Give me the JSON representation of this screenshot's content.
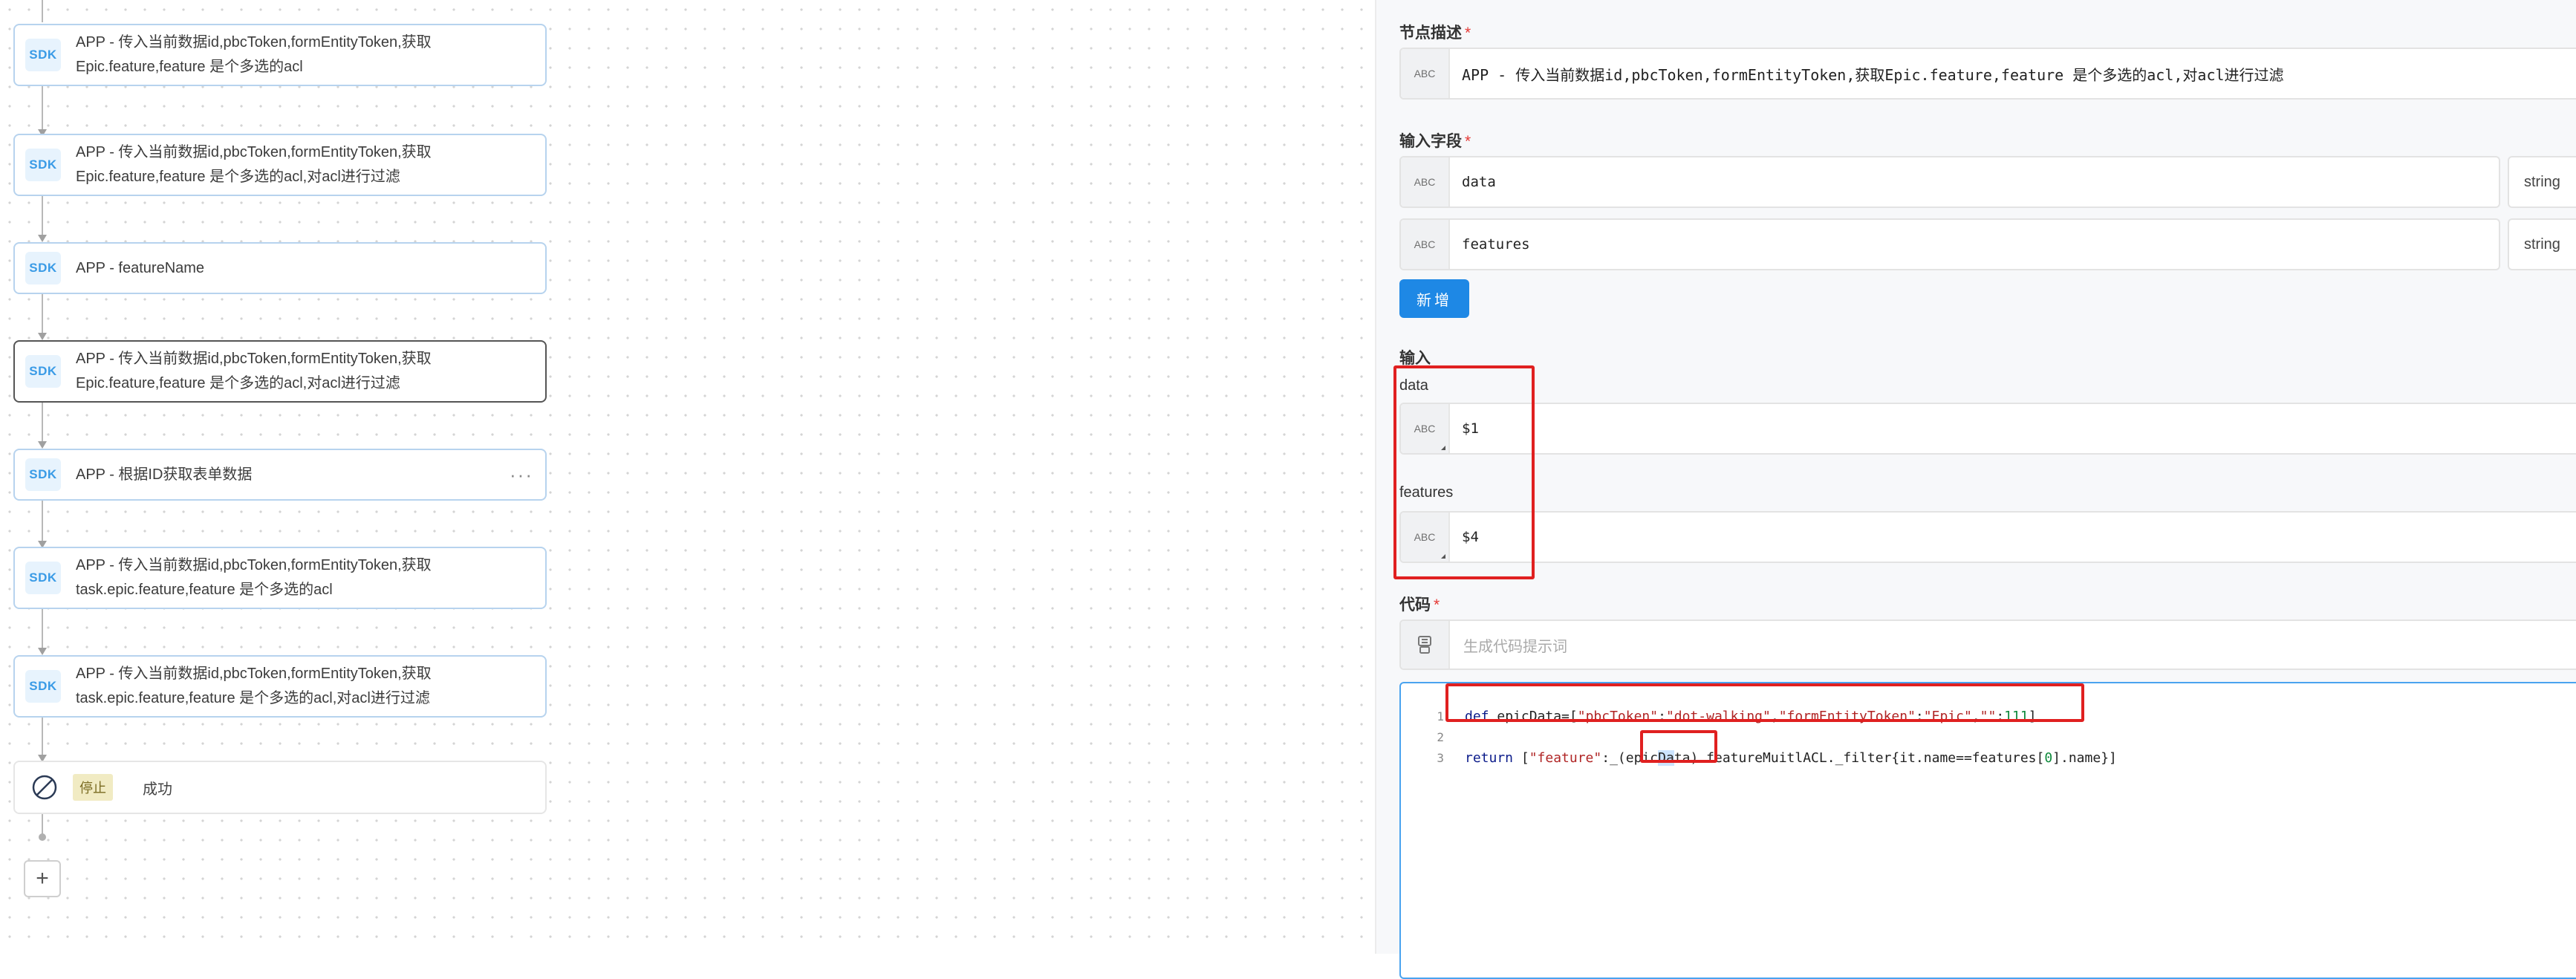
{
  "flow": {
    "nodes": [
      {
        "badge": "SDK",
        "line1": "APP - 传入当前数据id,pbcToken,formEntityToken,获取",
        "line2": "Epic.feature,feature 是个多选的acl"
      },
      {
        "badge": "SDK",
        "line1": "APP - 传入当前数据id,pbcToken,formEntityToken,获取",
        "line2": "Epic.feature,feature 是个多选的acl,对acl进行过滤"
      },
      {
        "badge": "SDK",
        "line1": "APP - featureName",
        "line2": ""
      },
      {
        "badge": "SDK",
        "line1": "APP - 传入当前数据id,pbcToken,formEntityToken,获取",
        "line2": "Epic.feature,feature 是个多选的acl,对acl进行过滤"
      },
      {
        "badge": "SDK",
        "line1": "APP - 根据ID获取表单数据",
        "line2": "",
        "menu": "···"
      },
      {
        "badge": "SDK",
        "line1": "APP - 传入当前数据id,pbcToken,formEntityToken,获取",
        "line2": "task.epic.feature,feature 是个多选的acl"
      },
      {
        "badge": "SDK",
        "line1": "APP - 传入当前数据id,pbcToken,formEntityToken,获取",
        "line2": "task.epic.feature,feature 是个多选的acl,对acl进行过滤"
      }
    ],
    "stop": {
      "tag": "停止",
      "label": "成功"
    },
    "add_symbol": "+"
  },
  "panel": {
    "node_desc": {
      "label": "节点描述",
      "required": "*",
      "abc": "ABC",
      "value": "APP - 传入当前数据id,pbcToken,formEntityToken,获取Epic.feature,feature 是个多选的acl,对acl进行过滤"
    },
    "input_fields": {
      "label": "输入字段",
      "required": "*",
      "rows": [
        {
          "abc": "ABC",
          "name": "data",
          "type": "string"
        },
        {
          "abc": "ABC",
          "name": "features",
          "type": "string"
        }
      ],
      "add_button": "新增"
    },
    "inputs": {
      "label": "输入",
      "items": [
        {
          "name": "data",
          "abc": "ABC",
          "value": "$1"
        },
        {
          "name": "features",
          "abc": "ABC",
          "value": "$4"
        }
      ]
    },
    "code": {
      "label": "代码",
      "required": "*",
      "prompt_placeholder": "生成代码提示词",
      "line_numbers": [
        "1",
        "2",
        "3"
      ],
      "line1": {
        "kw": "def ",
        "var": "epicData=[",
        "s1": "\"pbcToken\"",
        "c1": ":",
        "s2": "\"dot-walking\"",
        "c2": ",",
        "s3": "\"formEntityToken\"",
        "c3": ":",
        "s4": "\"Epic\"",
        "c4": ",",
        "s5": "\"\"",
        "c5": ":",
        "n1": "111",
        "c6": "]"
      },
      "line3": {
        "kw": "return ",
        "p1": "[",
        "s1": "\"feature\"",
        "p2": ":_(",
        "sel_a": "epic",
        "sel_b": "Da",
        "sel_c": "ta",
        "p3": ").featureMuitlACL._filter{it.name==features[",
        "n1": "0",
        "p4": "].name}]"
      }
    }
  }
}
